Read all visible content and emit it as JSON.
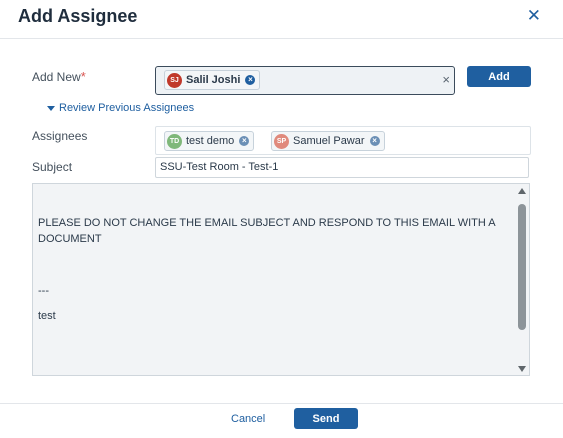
{
  "dialog": {
    "title": "Add Assignee",
    "close_icon": "close-icon"
  },
  "add_new": {
    "label": "Add New",
    "required_mark": "*",
    "chips": [
      {
        "initials": "SJ",
        "name": "Salil Joshi",
        "color": "#c0392b"
      }
    ],
    "clear_symbol": "×",
    "add_button": "Add"
  },
  "review_link": "Review Previous Assignees",
  "assignees": {
    "label": "Assignees",
    "chips": [
      {
        "initials": "TD",
        "name": "test demo",
        "color": "#7fb87a"
      },
      {
        "initials": "SP",
        "name": "Samuel Pawar",
        "color": "#e08a7d"
      }
    ]
  },
  "subject": {
    "label": "Subject",
    "value": "SSU-Test Room - Test-1"
  },
  "message": {
    "line1": "PLEASE DO NOT CHANGE THE EMAIL SUBJECT AND RESPOND TO THIS EMAIL WITH A DOCUMENT",
    "separator": "---",
    "line2": "test"
  },
  "footer": {
    "cancel": "Cancel",
    "send": "Send"
  },
  "colors": {
    "accent": "#1f5fa0",
    "chip_remove": "#6b8fb5"
  }
}
